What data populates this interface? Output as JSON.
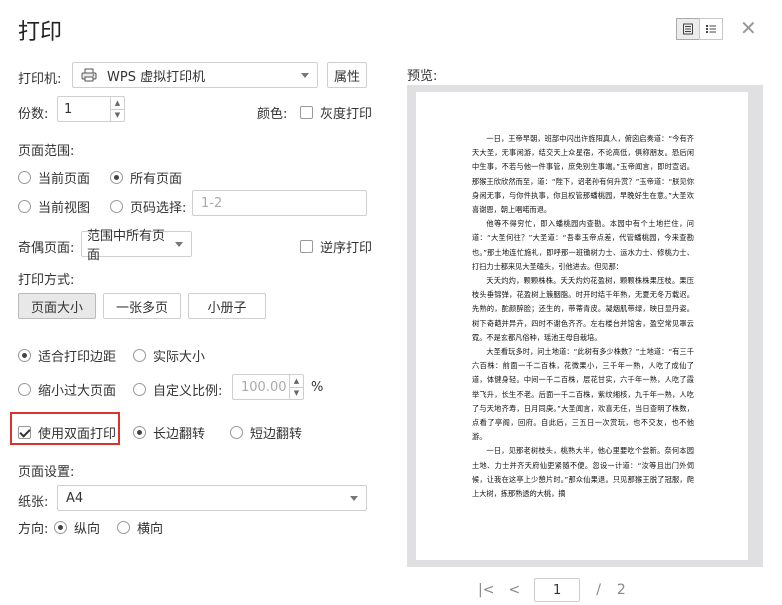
{
  "dialog": {
    "title": "打印",
    "printer_label": "打印机:",
    "printer_name": "WPS 虚拟打印机",
    "properties_button": "属性",
    "copies_label": "份数:",
    "copies_value": "1",
    "color_label": "颜色:",
    "grayscale_label": "灰度打印",
    "page_range_title": "页面范围:",
    "range_current_page": "当前页面",
    "range_all_pages": "所有页面",
    "range_current_view": "当前视图",
    "range_page_select": "页码选择:",
    "page_select_placeholder": "1-2",
    "odd_even_label": "奇偶页面:",
    "odd_even_value": "范围中所有页面",
    "reverse_label": "逆序打印",
    "print_mode_title": "打印方式:",
    "mode_buttons": [
      "页面大小",
      "一张多页",
      "小册子"
    ],
    "fit_margins": "适合打印边距",
    "actual_size": "实际大小",
    "shrink_large": "缩小过大页面",
    "custom_scale": "自定义比例:",
    "scale_value": "100.00",
    "percent": "%",
    "duplex_label": "使用双面打印",
    "long_edge": "长边翻转",
    "short_edge": "短边翻转",
    "page_setup_title": "页面设置:",
    "paper_label": "纸张:",
    "paper_value": "A4",
    "orientation_label": "方向:",
    "portrait": "纵向",
    "landscape": "横向",
    "preview_label": "预览:",
    "current_page": "1",
    "page_separator": "/",
    "total_pages": "2"
  },
  "preview_document": [
    "一日，王帝早朝，班部中闪出许旌阳真人，俯囟启奏道：“今有齐天大圣，无事闲游，结交天上众星宿，不论高低，俱称朋友。恐后闲中生事，不若与他一件事管，庶免别生事端。”玉帝闻言，即时宣诏。那猴王欣欣然而至，道：“陛下，诏老孙有何升赏？”玉帝道：“朕见你身闲无事，与你件执事，你且权管那蟠桃园，早晚好生在意。”大圣欢喜谢恩，朝上唱喏而退。",
    "他等不得穷忙，即入蟠桃园内查勘。本园中有个土地拦住，问道：“大圣何往？”大圣道：“吾奉玉帝点差，代管蟠桃园，今来查勘也。”那土地连忙施礼，即呼那一班锄树力士、运水力士、修桃力士、打扫力士都来见大圣磕头，引他进去。但见那：",
    "夭夭灼灼，颗颗株株。夭夭灼灼花盈树，颗颗株株果压枝。果压枝头垂锦弹，花盈树上簇胭脂。时开时结千年熟，无夏无冬万载迟。先熟的，酡颜醉脸；还生的，带蒂青皮。凝烟肌带绿，映日显丹姿。树下奇葩并异卉，四时不谢色齐齐。左右楼台并馆舍，盈空常见罩云霓。不是玄都凡俗种，瑶池王母自栽培。",
    "大圣看玩多时，问土地道：“此树有多少株数？”土地道：“有三千六百株：前面一千二百株，花微果小，三千年一熟，人吃了成仙了道，体健身轻。中间一千二百株，层花甘实，六千年一熟，人吃了霞举飞升，长生不老。后面一千二百株，紫纹缃核，九千年一熟，人吃了与天地齐寿，日月同庚。”大圣闻言，欢喜无任，当日查明了株数，点看了亭阁，回府。自此后，三五日一次赏玩，也不交友，也不他游。",
    "一日，见那老树枝头，桃熟大半，他心里要吃个尝新。奈何本园土地、力士并齐天府仙吏紧随不便。忽设一计道：“汝等且出门外伺候，让我在这亭上少憩片时。”那众仙果退。只见那猴王脱了冠服，爬上大树，拣那熟透的大桃，摘"
  ]
}
